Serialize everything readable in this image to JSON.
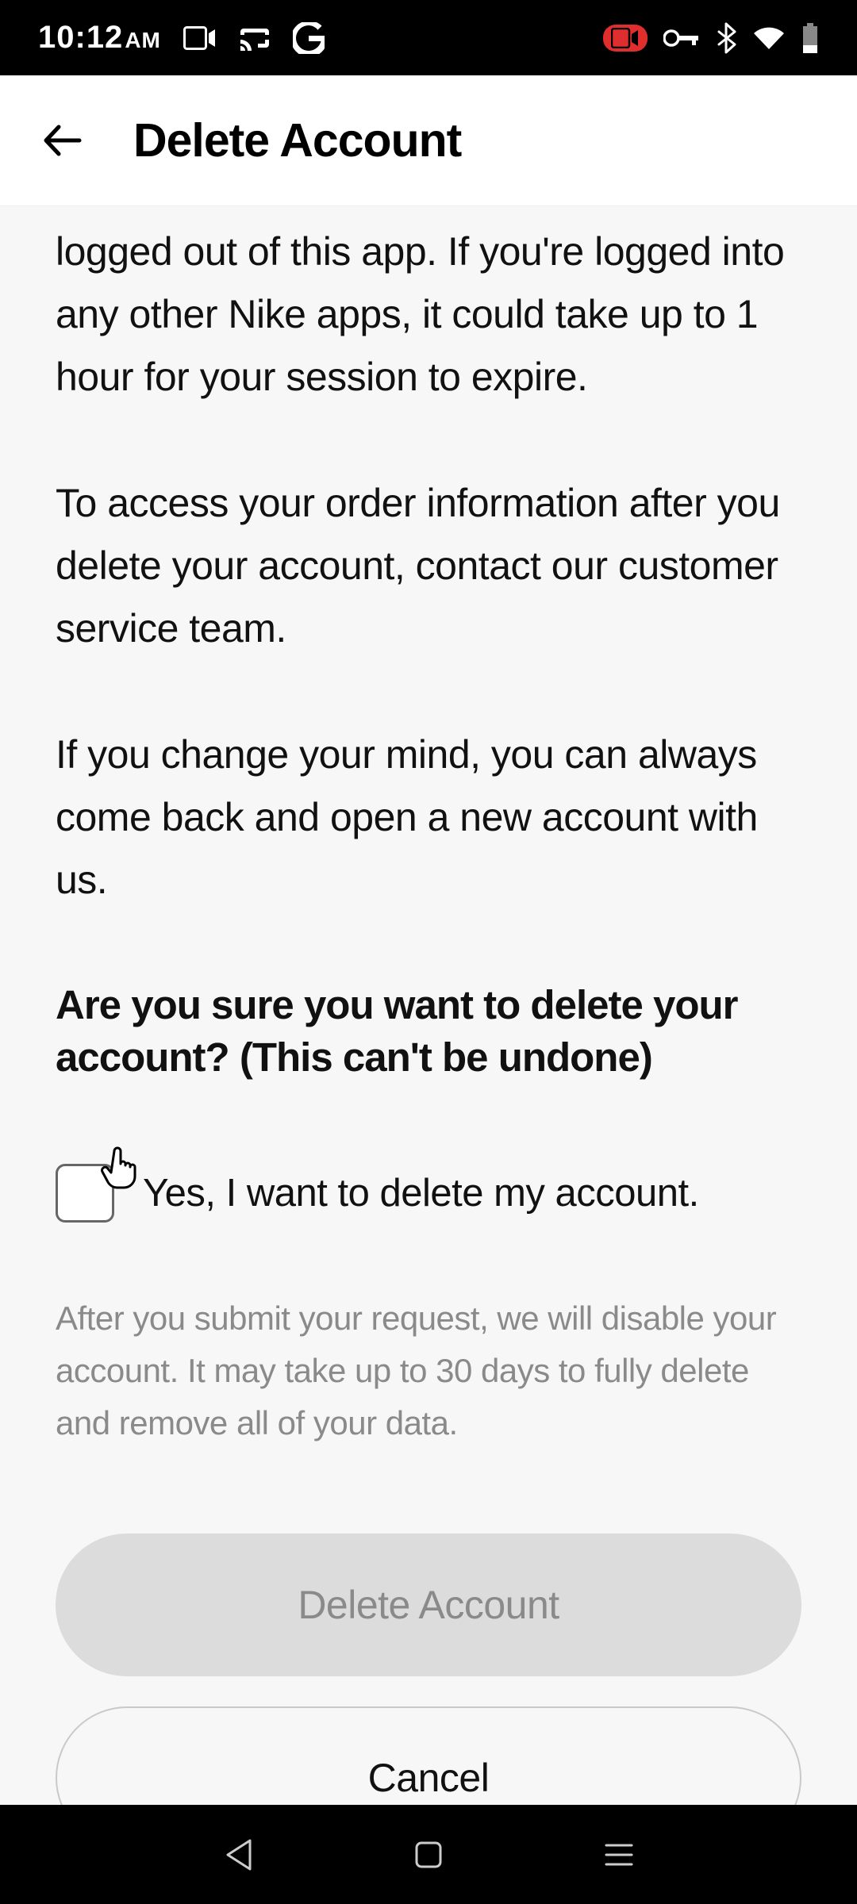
{
  "status_bar": {
    "time": "10:12",
    "ampm": "AM"
  },
  "app_bar": {
    "title": "Delete Account"
  },
  "content": {
    "paragraph1": "logged out of this app. If you're logged into any other Nike apps, it could take up to 1 hour for your session to expire.",
    "paragraph2": "To access your order information after you delete your account, contact our customer service team.",
    "paragraph3": "If you change your mind, you can always come back and open a new account with us.",
    "confirm_heading": "Are you sure you want to delete your account? (This can't be undone)",
    "checkbox_label": "Yes, I want to delete my account.",
    "disclaimer": "After you submit your request, we will disable your account. It may take up to 30 days to fully delete and remove all of your data.",
    "delete_button": "Delete Account",
    "cancel_button": "Cancel"
  }
}
